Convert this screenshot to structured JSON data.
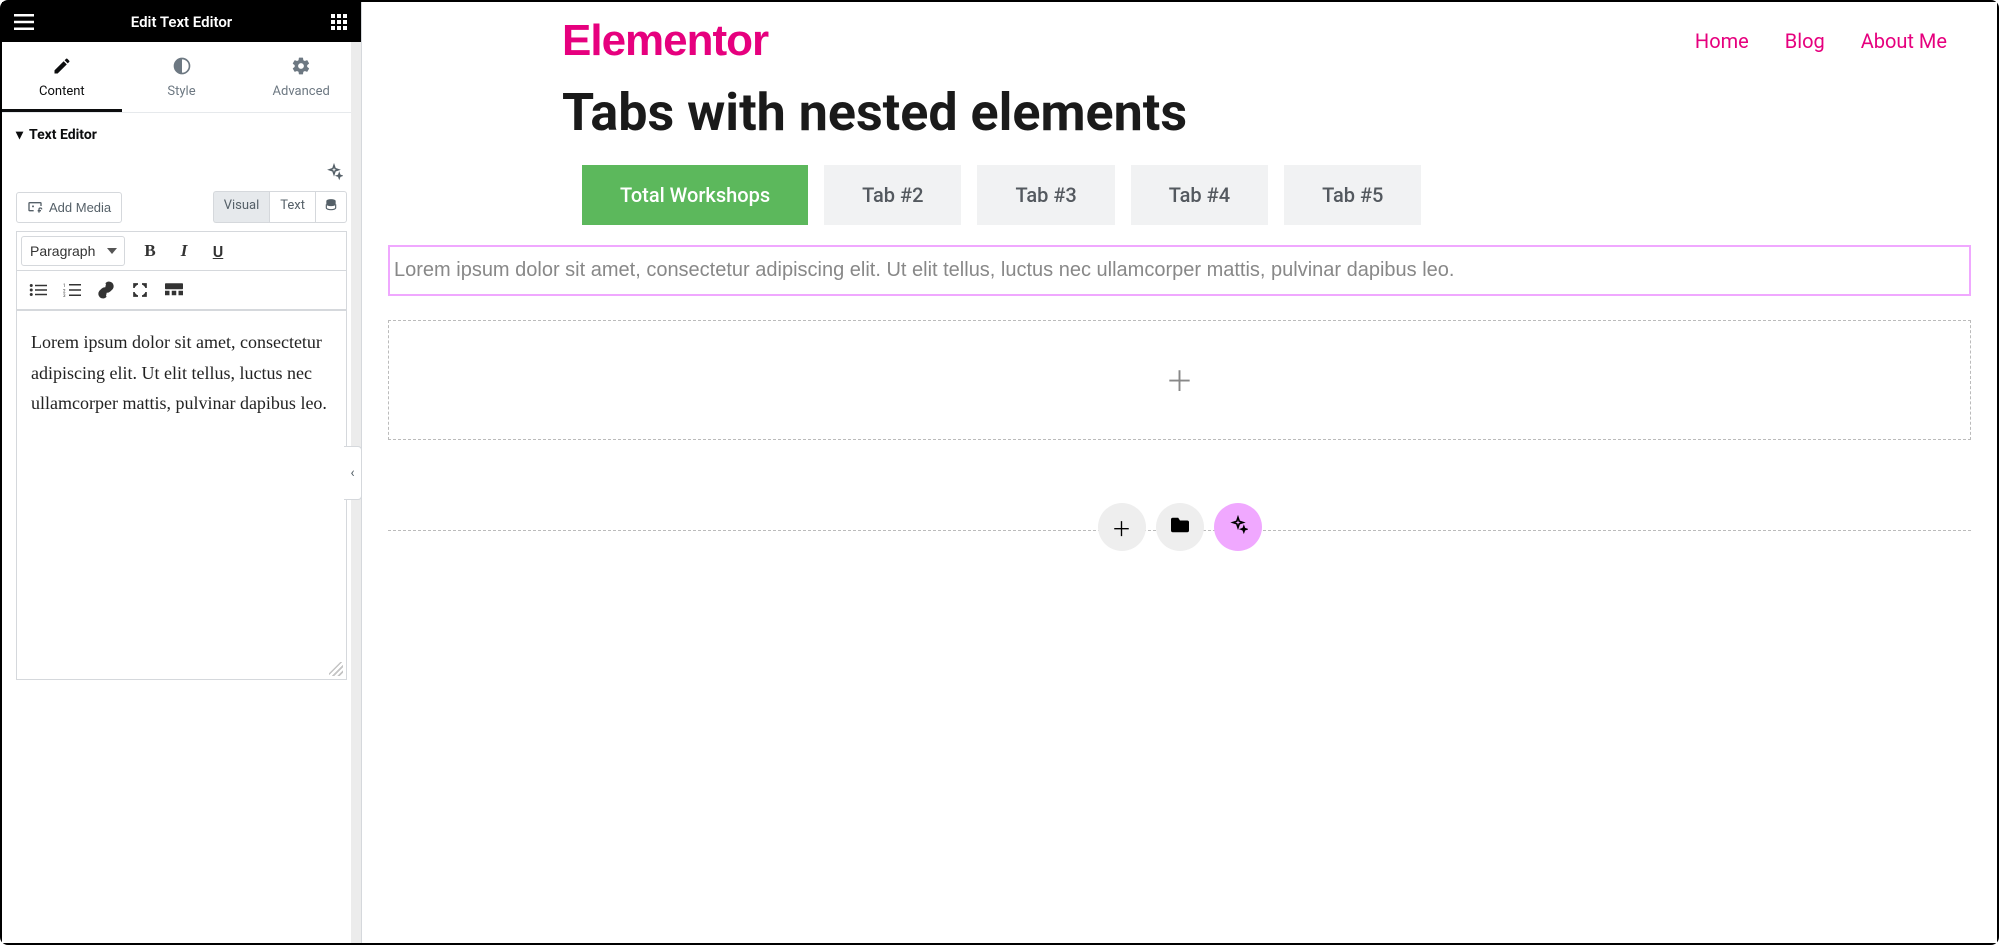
{
  "sidebar": {
    "title": "Edit Text Editor",
    "panel_tabs": [
      {
        "label": "Content",
        "icon": "pencil-icon"
      },
      {
        "label": "Style",
        "icon": "contrast-icon"
      },
      {
        "label": "Advanced",
        "icon": "gear-icon"
      }
    ],
    "active_panel_tab": 0,
    "section_label": "Text Editor",
    "add_media_label": "Add Media",
    "editor_modes": {
      "visual": "Visual",
      "text": "Text",
      "active": "Visual"
    },
    "paragraph_select": "Paragraph",
    "editor_content": "Lorem ipsum dolor sit amet, consectetur adipiscing elit. Ut elit tellus, luctus nec ullamcorper mattis, pulvinar dapibus leo."
  },
  "preview": {
    "brand": "Elementor",
    "nav": [
      "Home",
      "Blog",
      "About Me"
    ],
    "page_title": "Tabs with nested elements",
    "tabs": [
      "Total Workshops",
      "Tab #2",
      "Tab #3",
      "Tab #4",
      "Tab #5"
    ],
    "active_tab": 0,
    "content_text": "Lorem ipsum dolor sit amet, consectetur adipiscing elit. Ut elit tellus, luctus nec ullamcorper mattis, pulvinar dapibus leo."
  }
}
